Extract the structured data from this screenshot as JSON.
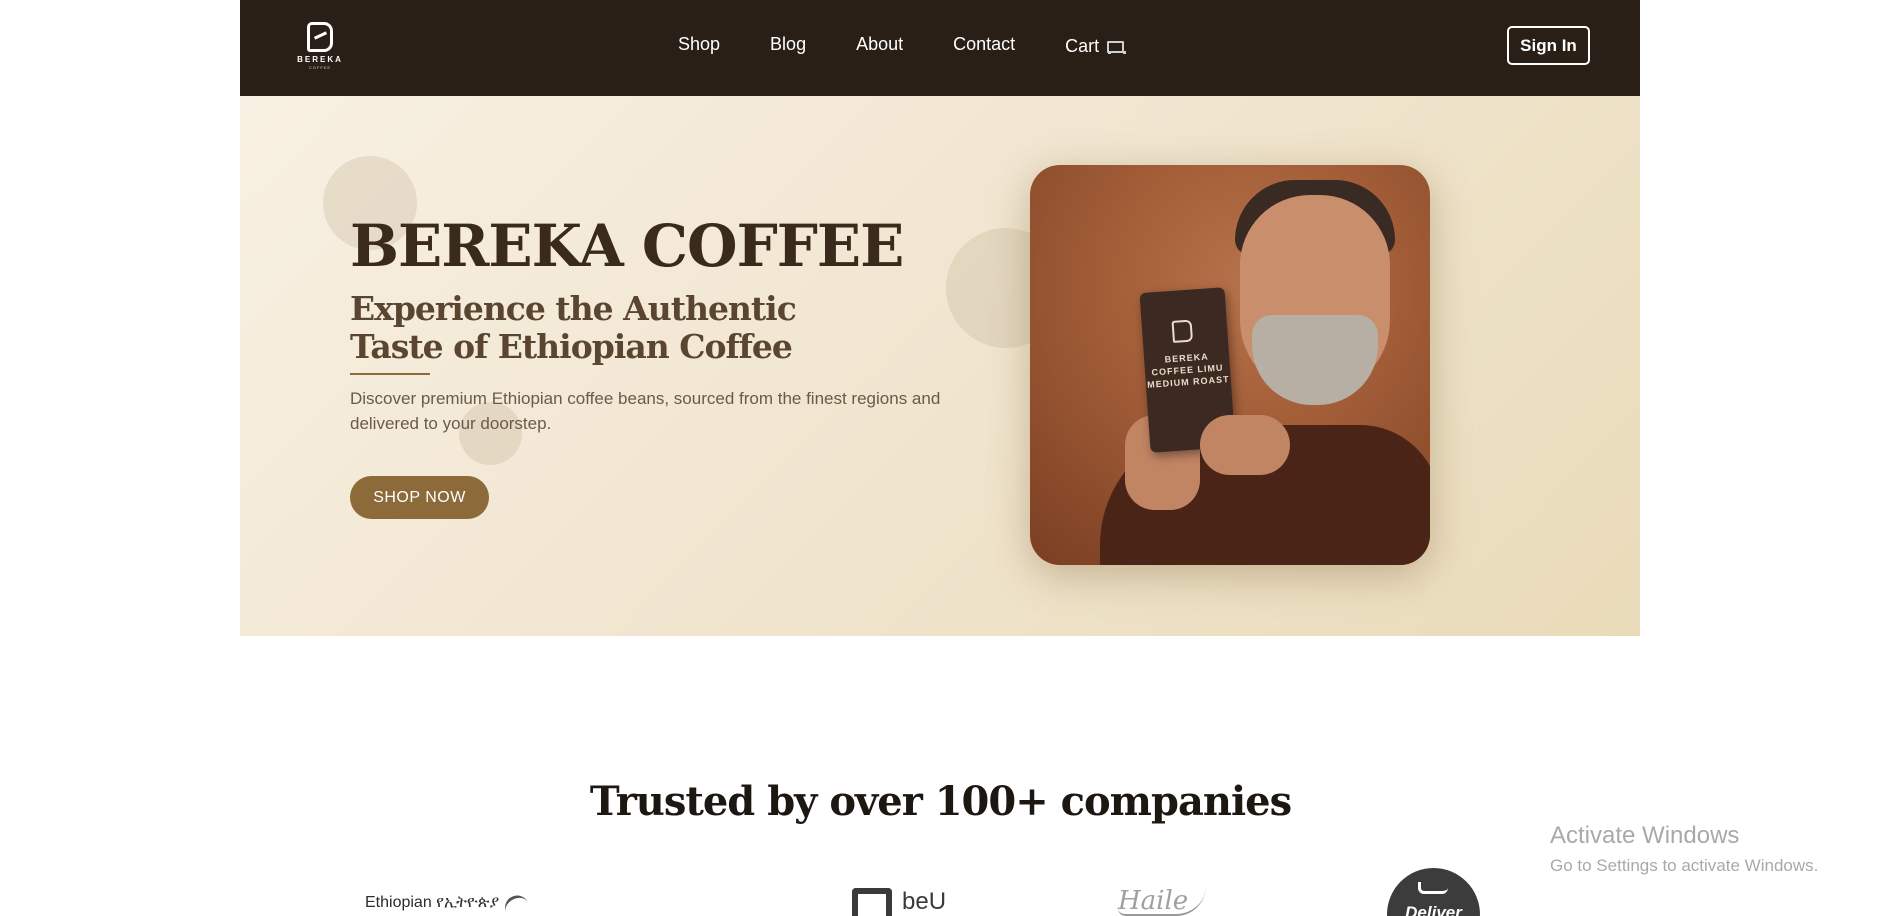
{
  "nav": {
    "logo_text": "BEREKA",
    "logo_subtext": "COFFEE",
    "links": [
      "Shop",
      "Blog",
      "About",
      "Contact"
    ],
    "cart_label": "Cart",
    "cart_icon": "cart-icon",
    "signin_label": "Sign In"
  },
  "hero": {
    "title": "BEREKA COFFEE",
    "subtitle": "Experience the Authentic Taste of Ethiopian Coffee",
    "description": "Discover premium Ethiopian coffee beans, sourced from the finest regions and delivered to your doorstep.",
    "cta_label": "SHOP NOW",
    "product_bag_text": "BEREKA COFFEE LIMU MEDIUM ROAST",
    "accent_color": "#8c6a3a"
  },
  "trusted": {
    "title": "Trusted by over 100+ companies",
    "partner_logos": [
      {
        "name": "Ethiopian",
        "text": "Ethiopian የኢትዮጵያ"
      },
      {
        "name": "beU",
        "text": "beU"
      },
      {
        "name": "signature",
        "text": "Haile"
      },
      {
        "name": "deliver",
        "text": "Deliver"
      }
    ]
  },
  "watermark": {
    "title": "Activate Windows",
    "subtitle": "Go to Settings to activate Windows."
  }
}
